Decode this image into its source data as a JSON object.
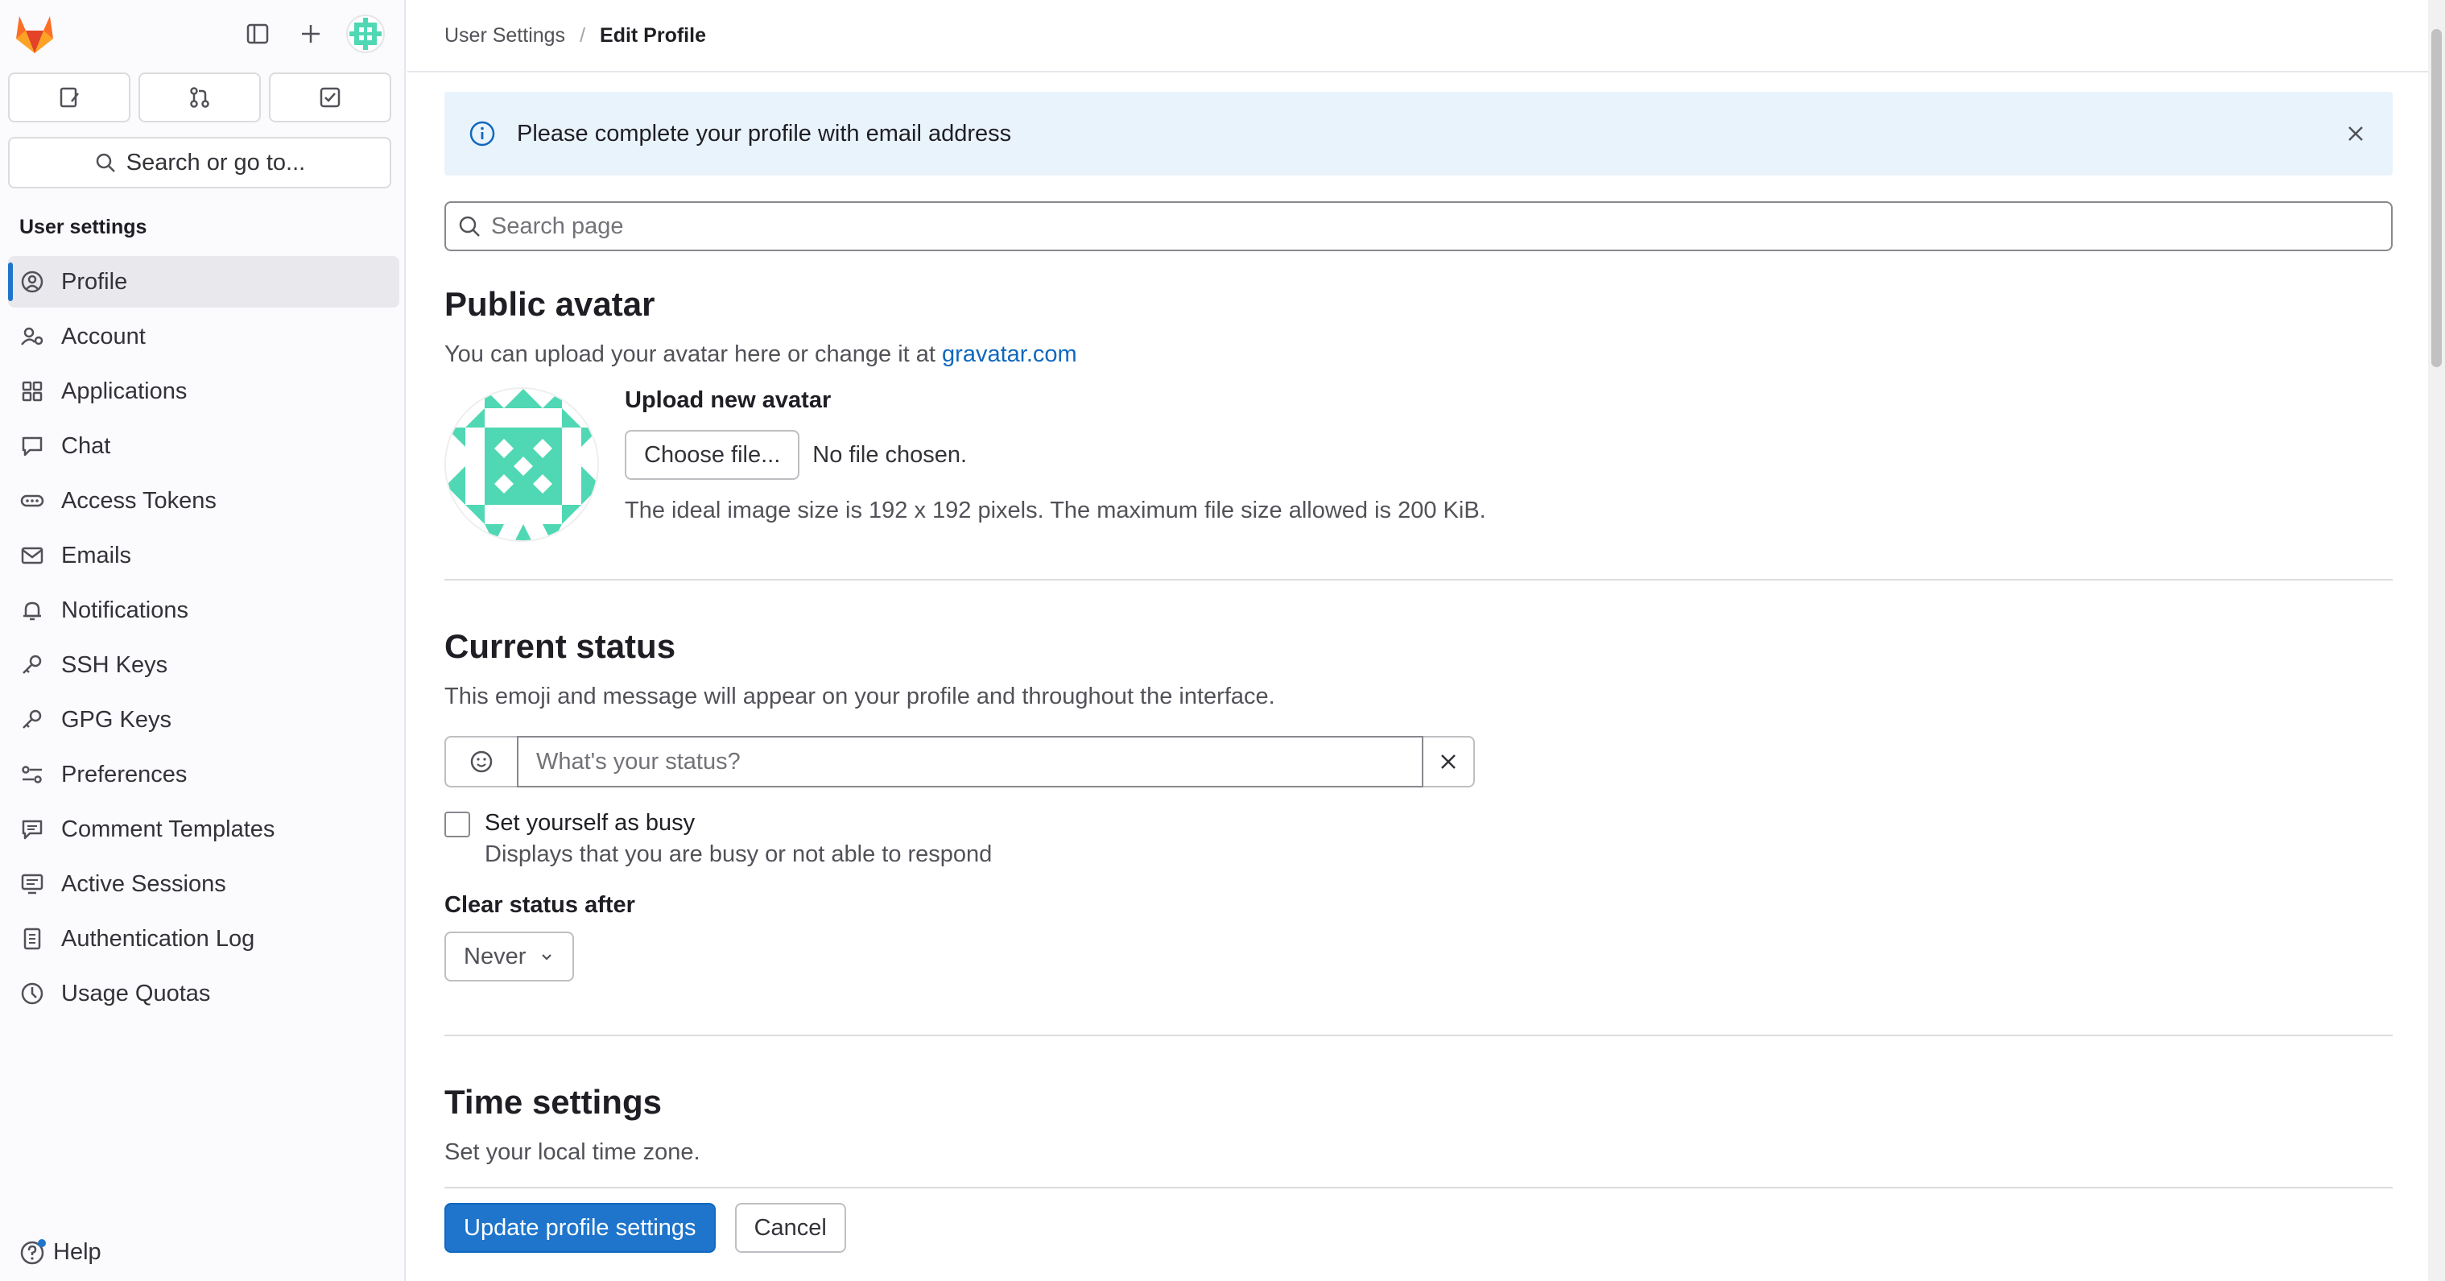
{
  "sidebar": {
    "search_label": "Search or go to...",
    "section_title": "User settings",
    "items": [
      {
        "label": "Profile",
        "icon": "profile-icon"
      },
      {
        "label": "Account",
        "icon": "account-icon"
      },
      {
        "label": "Applications",
        "icon": "applications-icon"
      },
      {
        "label": "Chat",
        "icon": "chat-icon"
      },
      {
        "label": "Access Tokens",
        "icon": "token-icon"
      },
      {
        "label": "Emails",
        "icon": "mail-icon"
      },
      {
        "label": "Notifications",
        "icon": "bell-icon"
      },
      {
        "label": "SSH Keys",
        "icon": "key-icon"
      },
      {
        "label": "GPG Keys",
        "icon": "key-icon"
      },
      {
        "label": "Preferences",
        "icon": "preferences-icon"
      },
      {
        "label": "Comment Templates",
        "icon": "comment-template-icon"
      },
      {
        "label": "Active Sessions",
        "icon": "monitor-icon"
      },
      {
        "label": "Authentication Log",
        "icon": "log-icon"
      },
      {
        "label": "Usage Quotas",
        "icon": "quota-icon"
      }
    ],
    "help_label": "Help"
  },
  "breadcrumb": {
    "parent": "User Settings",
    "separator": "/",
    "current": "Edit Profile"
  },
  "alert": {
    "message": "Please complete your profile with email address"
  },
  "page_search": {
    "placeholder": "Search page"
  },
  "avatar_section": {
    "title": "Public avatar",
    "description_prefix": "You can upload your avatar here or change it at",
    "description_link": "gravatar.com",
    "upload_label": "Upload new avatar",
    "choose_button": "Choose file...",
    "no_file": "No file chosen.",
    "hint": "The ideal image size is 192 x 192 pixels. The maximum file size allowed is 200 KiB."
  },
  "status_section": {
    "title": "Current status",
    "description": "This emoji and message will appear on your profile and throughout the interface.",
    "placeholder": "What's your status?",
    "busy_label": "Set yourself as busy",
    "busy_help": "Displays that you are busy or not able to respond",
    "clear_label": "Clear status after",
    "clear_value": "Never"
  },
  "time_section": {
    "title": "Time settings",
    "description": "Set your local time zone."
  },
  "actions": {
    "submit": "Update profile settings",
    "cancel": "Cancel"
  },
  "colors": {
    "primary": "#1f75cb",
    "alert_bg": "#e9f3fc",
    "avatar": "#4fd8b3",
    "logo": "#e24329"
  }
}
